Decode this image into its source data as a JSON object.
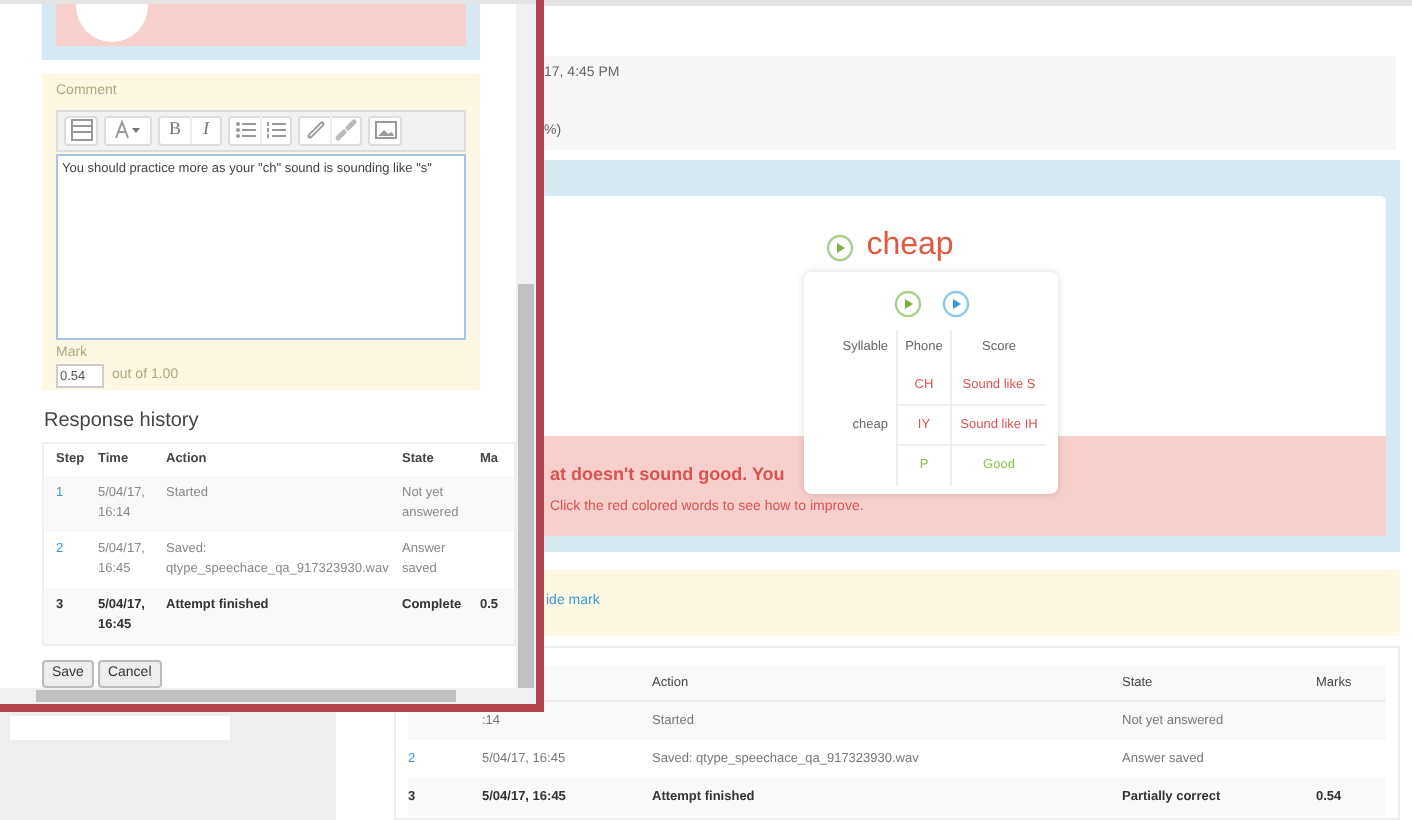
{
  "background": {
    "info_rows": [
      "17, 4:45 PM",
      "%)"
    ],
    "question": {
      "word": "cheap",
      "feedback_title": "at doesn't sound good. You",
      "feedback_hint": "Click the red colored words to see how to improve."
    },
    "tooltip": {
      "columns": [
        "Syllable",
        "Phone",
        "Score"
      ],
      "syllable": "cheap",
      "phones": [
        {
          "phone": "CH",
          "score": "Sound like S",
          "good": false
        },
        {
          "phone": "IY",
          "score": "Sound like IH",
          "good": false
        },
        {
          "phone": "P",
          "score": "Good",
          "good": true
        }
      ]
    },
    "comment_link": "ide mark",
    "history": {
      "columns": [
        "Action",
        "State",
        "Marks"
      ],
      "rows": [
        {
          "step": "",
          "time": ":14",
          "action": "Started",
          "state": "Not yet answered",
          "marks": "",
          "final": false
        },
        {
          "step": "2",
          "time": "5/04/17, 16:45",
          "action": "Saved: qtype_speechace_qa_917323930.wav",
          "state": "Answer saved",
          "marks": "",
          "final": false
        },
        {
          "step": "3",
          "time": "5/04/17, 16:45",
          "action": "Attempt finished",
          "state": "Partially correct",
          "marks": "0.54",
          "final": true
        }
      ]
    }
  },
  "popup": {
    "comment": {
      "label": "Comment",
      "toolbar": [
        [
          {
            "kind": "table"
          }
        ],
        [
          {
            "kind": "fontsize"
          }
        ],
        [
          {
            "kind": "bold",
            "label": "B"
          },
          {
            "kind": "italic",
            "label": "I"
          }
        ],
        [
          {
            "kind": "bullets"
          },
          {
            "kind": "numbers"
          }
        ],
        [
          {
            "kind": "link"
          },
          {
            "kind": "unlink"
          }
        ],
        [
          {
            "kind": "image"
          }
        ]
      ],
      "text": "You should practice more as your \"ch\" sound is sounding like \"s\""
    },
    "mark": {
      "label": "Mark",
      "value": "0.54",
      "suffix": "out of 1.00"
    },
    "history": {
      "title": "Response history",
      "columns": [
        "Step",
        "Time",
        "Action",
        "State",
        "Ma"
      ],
      "rows": [
        {
          "step": "1",
          "time": "5/04/17, 16:14",
          "action": "Started",
          "state": "Not yet answered",
          "marks": "",
          "final": false
        },
        {
          "step": "2",
          "time": "5/04/17, 16:45",
          "action": "Saved: qtype_speechace_qa_917323930.wav",
          "state": "Answer saved",
          "marks": "",
          "final": false
        },
        {
          "step": "3",
          "time": "5/04/17, 16:45",
          "action": "Attempt finished",
          "state": "Complete",
          "marks": "0.5",
          "final": true
        }
      ]
    },
    "buttons": [
      "Save",
      "Cancel"
    ]
  }
}
